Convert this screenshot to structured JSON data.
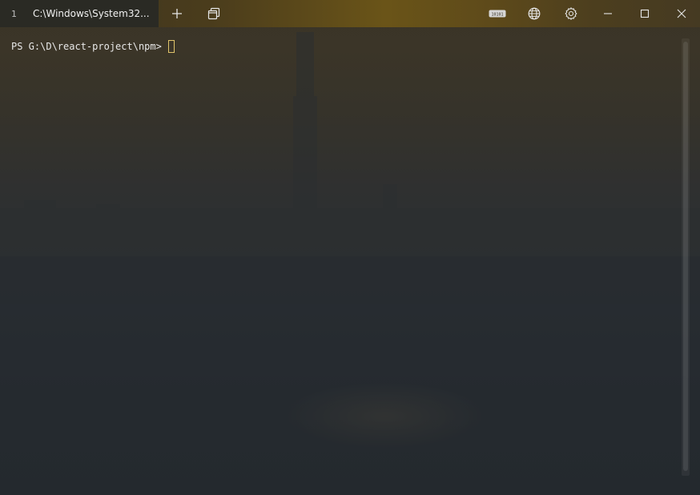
{
  "tab": {
    "index": "1",
    "title": "C:\\Windows\\System32..."
  },
  "toolbar": {
    "new_tab_icon": "plus-icon",
    "switch_window_icon": "window-stack-icon",
    "ssh_icon": "server-connection-icon",
    "network_icon": "globe-icon",
    "settings_icon": "gear-icon",
    "minimize_icon": "minimize-icon",
    "maximize_icon": "maximize-icon",
    "close_icon": "close-icon"
  },
  "terminal": {
    "prompt": "PS G:\\D\\react-project\\npm> "
  },
  "colors": {
    "accent_cursor": "#e0c46a",
    "text": "#e8e8e8",
    "tab_background": "#2a2a24"
  }
}
